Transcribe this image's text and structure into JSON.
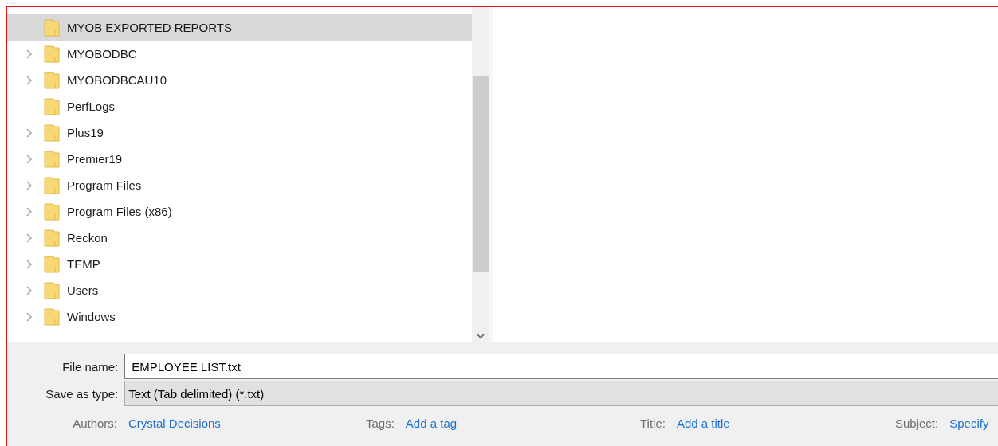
{
  "tree": {
    "items": [
      {
        "label": "MYOB EXPORTED REPORTS",
        "expandable": false,
        "selected": true
      },
      {
        "label": "MYOBODBC",
        "expandable": true,
        "selected": false
      },
      {
        "label": "MYOBODBCAU10",
        "expandable": true,
        "selected": false
      },
      {
        "label": "PerfLogs",
        "expandable": false,
        "selected": false
      },
      {
        "label": "Plus19",
        "expandable": true,
        "selected": false
      },
      {
        "label": "Premier19",
        "expandable": true,
        "selected": false
      },
      {
        "label": "Program Files",
        "expandable": true,
        "selected": false
      },
      {
        "label": "Program Files (x86)",
        "expandable": true,
        "selected": false
      },
      {
        "label": "Reckon",
        "expandable": true,
        "selected": false
      },
      {
        "label": "TEMP",
        "expandable": true,
        "selected": false
      },
      {
        "label": "Users",
        "expandable": true,
        "selected": false
      },
      {
        "label": "Windows",
        "expandable": true,
        "selected": false
      }
    ]
  },
  "file_name": {
    "label": "File name:",
    "value": "EMPLOYEE LIST.txt"
  },
  "save_as_type": {
    "label": "Save as type:",
    "value": "Text (Tab delimited) (*.txt)"
  },
  "metadata": [
    {
      "label": "Authors:",
      "value": "Crystal Decisions"
    },
    {
      "label": "Tags:",
      "value": "Add a tag"
    },
    {
      "label": "Title:",
      "value": "Add a title"
    },
    {
      "label": "Subject:",
      "value": "Specify"
    }
  ]
}
